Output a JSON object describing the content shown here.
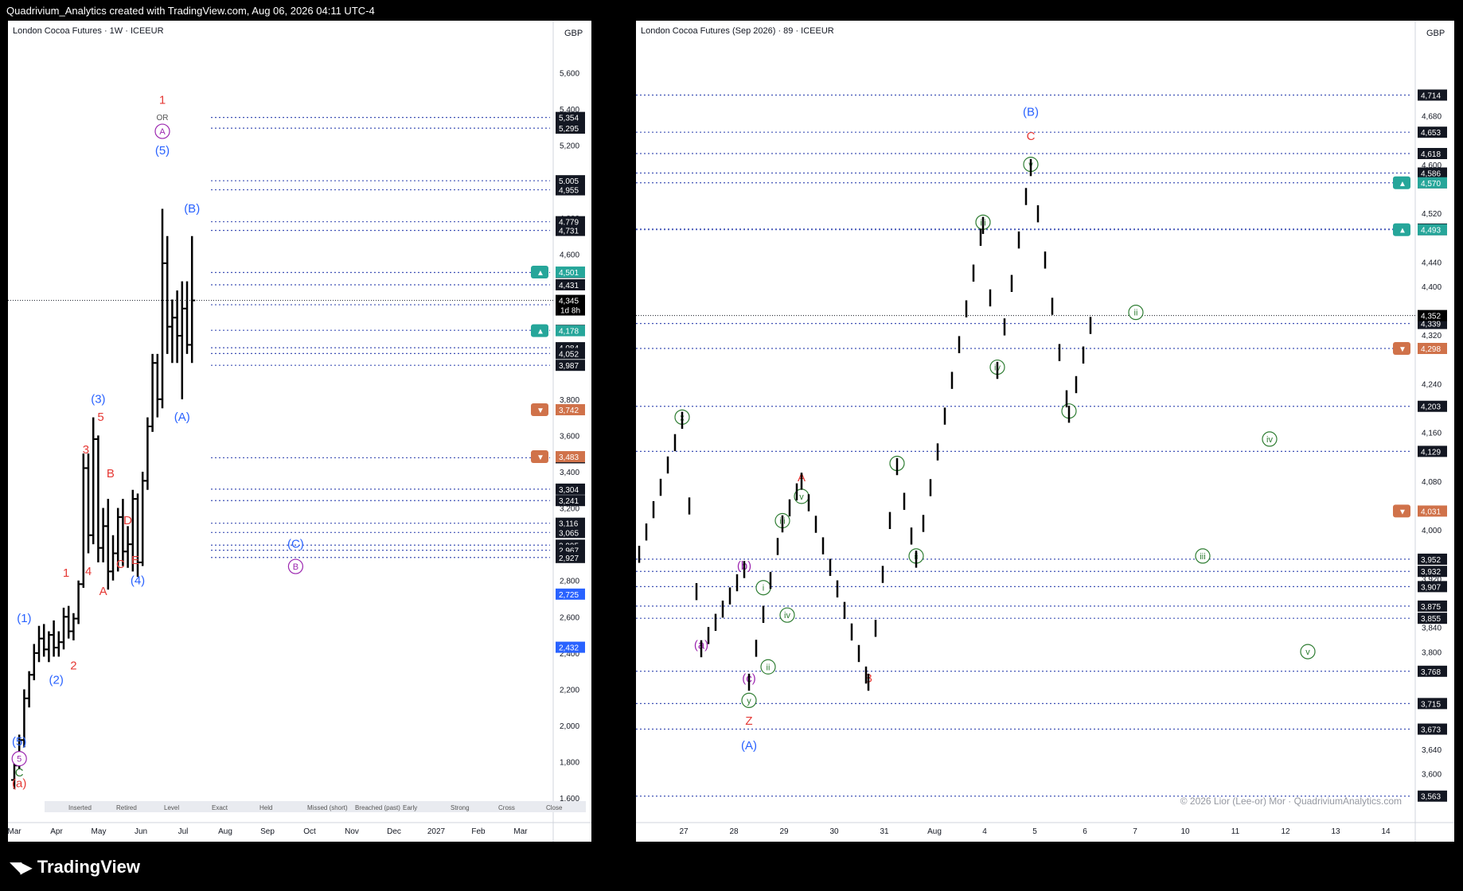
{
  "header": {
    "caption": "Quadrivium_Analytics created with TradingView.com, Aug 06, 2026 04:11 UTC-4"
  },
  "footer": {
    "brand": "TradingView",
    "logo_icon": "tradingview-logo-icon"
  },
  "colors": {
    "up_marker": "#26a69a",
    "down_marker": "#d0724a",
    "wave_blue": "#2962ff",
    "wave_red": "#e53935",
    "wave_green": "#2e7d32",
    "wave_purple": "#9c27b0",
    "last_price": "#000000"
  },
  "chart_data": [
    {
      "type": "bar",
      "title": "London Cocoa Futures · 1W · ICEEUR",
      "currency": "GBP",
      "ylim": [
        1500,
        5800
      ],
      "y_ticks": [
        "5,600",
        "5,400",
        "5,200",
        "4,800",
        "4,600",
        "3,800",
        "3,600",
        "3,400",
        "3,200",
        "2,800",
        "2,600",
        "2,400",
        "2,200",
        "2,000",
        "1,800",
        "1,600"
      ],
      "x_ticks": [
        "Mar",
        "Apr",
        "May",
        "Jun",
        "Jul",
        "Aug",
        "Sep",
        "Oct",
        "Nov",
        "Dec",
        "2027",
        "Feb",
        "Mar"
      ],
      "levels": [
        "5,354",
        "5,295",
        "5,005",
        "4,955",
        "4,779",
        "4,731",
        "4,499",
        "4,431",
        "4,321",
        "4,180",
        "4,084",
        "4,052",
        "3,987",
        "3,477",
        "3,304",
        "3,241",
        "3,116",
        "3,065",
        "2,995",
        "2,967",
        "2,927"
      ],
      "price_markers": [
        {
          "label": "4,501",
          "value": 4501,
          "kind": "up"
        },
        {
          "label": "4,178",
          "value": 4178,
          "kind": "up"
        },
        {
          "label": "3,742",
          "value": 3742,
          "kind": "down"
        },
        {
          "label": "3,483",
          "value": 3483,
          "kind": "down"
        },
        {
          "label": "2,725",
          "value": 2725,
          "kind": "blue"
        },
        {
          "label": "2,432",
          "value": 2432,
          "kind": "blue"
        }
      ],
      "last_price": {
        "value": "4,345",
        "sub": "1d 8h"
      },
      "wave_labels": [
        {
          "text": "1",
          "color": "red",
          "week": 30,
          "value": 5430
        },
        {
          "text": "OR",
          "color": "gray",
          "week": 30,
          "value": 5340
        },
        {
          "text": "A",
          "color": "purple",
          "week": 30,
          "value": 5260
        },
        {
          "text": "(5)",
          "color": "blue",
          "week": 30,
          "value": 5150
        },
        {
          "text": "(B)",
          "color": "blue",
          "week": 36,
          "value": 4830
        },
        {
          "text": "(A)",
          "color": "blue",
          "week": 34,
          "value": 3680
        },
        {
          "text": "(3)",
          "color": "blue",
          "week": 17,
          "value": 3780
        },
        {
          "text": "5",
          "color": "red",
          "week": 17.5,
          "value": 3680
        },
        {
          "text": "3",
          "color": "red",
          "week": 14.5,
          "value": 3500
        },
        {
          "text": "B",
          "color": "red",
          "week": 19.5,
          "value": 3370
        },
        {
          "text": "D",
          "color": "red",
          "week": 23,
          "value": 3110
        },
        {
          "text": "C",
          "color": "red",
          "week": 21.5,
          "value": 2870
        },
        {
          "text": "E",
          "color": "red",
          "week": 24.5,
          "value": 2890
        },
        {
          "text": "4",
          "color": "red",
          "week": 15,
          "value": 2830
        },
        {
          "text": "(4)",
          "color": "blue",
          "week": 25,
          "value": 2780
        },
        {
          "text": "A",
          "color": "red",
          "week": 18,
          "value": 2720
        },
        {
          "text": "1",
          "color": "red",
          "week": 10.5,
          "value": 2820
        },
        {
          "text": "2",
          "color": "red",
          "week": 12,
          "value": 2310
        },
        {
          "text": "(1)",
          "color": "blue",
          "week": 2,
          "value": 2570
        },
        {
          "text": "(2)",
          "color": "blue",
          "week": 8.5,
          "value": 2230
        },
        {
          "text": "(5)",
          "color": "blue",
          "week": 1,
          "value": 1890
        },
        {
          "text": "5",
          "color": "purple",
          "week": 1,
          "value": 1800
        },
        {
          "text": "C",
          "color": "green",
          "week": 1,
          "value": 1720
        },
        {
          "text": "(a)",
          "color": "red",
          "week": 1,
          "value": 1660
        },
        {
          "text": "(C)",
          "color": "blue",
          "week": 57,
          "value": 2980
        },
        {
          "text": "B",
          "color": "purple",
          "week": 57,
          "value": 2860
        }
      ],
      "legend": [
        "Inserted",
        "Retired",
        "Level",
        "Exact",
        "Held",
        "Missed (short)",
        "Breached (past)",
        "Early",
        "Strong",
        "Cross",
        "Close"
      ],
      "ohlc": [
        [
          1700,
          1800,
          1650,
          1780
        ],
        [
          1780,
          1950,
          1760,
          1920
        ],
        [
          1920,
          2200,
          1880,
          2150
        ],
        [
          2150,
          2300,
          2100,
          2280
        ],
        [
          2280,
          2450,
          2250,
          2400
        ],
        [
          2400,
          2550,
          2350,
          2480
        ],
        [
          2480,
          2560,
          2380,
          2420
        ],
        [
          2420,
          2520,
          2350,
          2500
        ],
        [
          2500,
          2580,
          2380,
          2430
        ],
        [
          2430,
          2520,
          2380,
          2460
        ],
        [
          2460,
          2650,
          2420,
          2600
        ],
        [
          2600,
          2660,
          2480,
          2520
        ],
        [
          2520,
          2620,
          2470,
          2590
        ],
        [
          2590,
          2800,
          2560,
          2780
        ],
        [
          2780,
          3500,
          2760,
          3420
        ],
        [
          3420,
          3500,
          2950,
          3050
        ],
        [
          3050,
          3700,
          3000,
          3580
        ],
        [
          3580,
          3600,
          2900,
          2980
        ],
        [
          2980,
          3200,
          2900,
          3100
        ],
        [
          3100,
          3250,
          2750,
          2850
        ],
        [
          2850,
          3050,
          2800,
          2950
        ],
        [
          2950,
          3200,
          2850,
          3150
        ],
        [
          3150,
          3250,
          2880,
          2960
        ],
        [
          2960,
          3100,
          2870,
          3000
        ],
        [
          3000,
          3300,
          2850,
          3250
        ],
        [
          3250,
          3280,
          2820,
          2900
        ],
        [
          2900,
          3400,
          2880,
          3350
        ],
        [
          3350,
          3700,
          3300,
          3650
        ],
        [
          3650,
          4050,
          3620,
          4000
        ],
        [
          4000,
          4050,
          3700,
          3800
        ],
        [
          3800,
          4850,
          3750,
          4550
        ],
        [
          4550,
          4700,
          4050,
          4200
        ],
        [
          4200,
          4350,
          4000,
          4250
        ],
        [
          4250,
          4400,
          4000,
          4150
        ],
        [
          4150,
          4450,
          3800,
          4300
        ],
        [
          4300,
          4450,
          4050,
          4100
        ],
        [
          4100,
          4700,
          4000,
          4345
        ]
      ]
    },
    {
      "type": "bar",
      "title": "London Cocoa Futures (Sep 2026) · 89 · ICEEUR",
      "currency": "GBP",
      "ylim": [
        3530,
        4810
      ],
      "y_ticks": [
        "4,680",
        "4,600",
        "4,520",
        "4,440",
        "4,400",
        "4,320",
        "4,240",
        "4,160",
        "4,080",
        "4,000",
        "3,920",
        "3,840",
        "3,800",
        "3,720",
        "3,640",
        "3,600"
      ],
      "x_ticks": [
        "27",
        "28",
        "29",
        "30",
        "31",
        "Aug",
        "4",
        "5",
        "6",
        "7",
        "10",
        "11",
        "12",
        "13",
        "14"
      ],
      "levels": [
        "4,714",
        "4,653",
        "4,618",
        "4,586",
        "4,570",
        "4,494",
        "4,493",
        "4,339",
        "4,298",
        "4,203",
        "4,129",
        "3,952",
        "3,932",
        "3,907",
        "3,875",
        "3,855",
        "3,768",
        "3,715",
        "3,673",
        "3,563"
      ],
      "price_markers": [
        {
          "label": "4,570",
          "value": 4570,
          "kind": "up"
        },
        {
          "label": "4,493",
          "value": 4493,
          "kind": "up"
        },
        {
          "label": "4,298",
          "value": 4298,
          "kind": "down"
        },
        {
          "label": "4,031",
          "value": 4031,
          "kind": "down"
        }
      ],
      "last_price": {
        "value": "4,352"
      },
      "wave_labels": [
        {
          "text": "(B)",
          "color": "blue",
          "bar": 82,
          "value": 4680
        },
        {
          "text": "C",
          "color": "red",
          "bar": 82,
          "value": 4640
        },
        {
          "text": "v",
          "color": "green-circle",
          "bar": 82,
          "value": 4595
        },
        {
          "text": "iii",
          "color": "green-circle",
          "bar": 72,
          "value": 4500
        },
        {
          "text": "ii",
          "color": "green-circle",
          "bar": 104,
          "value": 4352
        },
        {
          "text": "iv",
          "color": "green-circle",
          "bar": 75,
          "value": 4262
        },
        {
          "text": "i",
          "color": "green-circle",
          "bar": 90,
          "value": 4190
        },
        {
          "text": "iv",
          "color": "green-circle",
          "bar": 132,
          "value": 4144
        },
        {
          "text": "iii",
          "color": "green-circle",
          "bar": 118,
          "value": 3952
        },
        {
          "text": "v",
          "color": "green-circle",
          "bar": 140,
          "value": 3795
        },
        {
          "text": "x",
          "color": "green-circle",
          "bar": 9,
          "value": 4180
        },
        {
          "text": "i",
          "color": "green-circle",
          "bar": 54,
          "value": 4104
        },
        {
          "text": "ii",
          "color": "green-circle",
          "bar": 58,
          "value": 3952
        },
        {
          "text": "A",
          "color": "red",
          "bar": 34,
          "value": 4080
        },
        {
          "text": "v",
          "color": "green-circle",
          "bar": 34,
          "value": 4050
        },
        {
          "text": "iii",
          "color": "green-circle",
          "bar": 30,
          "value": 4010
        },
        {
          "text": "(b)",
          "color": "purple",
          "bar": 22,
          "value": 3935
        },
        {
          "text": "i",
          "color": "green-circle",
          "bar": 26,
          "value": 3900
        },
        {
          "text": "iv",
          "color": "green-circle",
          "bar": 31,
          "value": 3855
        },
        {
          "text": "(a)",
          "color": "purple",
          "bar": 13,
          "value": 3805
        },
        {
          "text": "ii",
          "color": "green-circle",
          "bar": 27,
          "value": 3770
        },
        {
          "text": "(c)",
          "color": "purple",
          "bar": 23,
          "value": 3750
        },
        {
          "text": "y",
          "color": "green-circle",
          "bar": 23,
          "value": 3715
        },
        {
          "text": "Z",
          "color": "red",
          "bar": 23,
          "value": 3680
        },
        {
          "text": "(A)",
          "color": "blue",
          "bar": 23,
          "value": 3640
        },
        {
          "text": "B",
          "color": "red",
          "bar": 48,
          "value": 3750
        }
      ],
      "copyright": "© 2026 Lior (Lee-or) Mor · QuadriviumAnalytics.com"
    }
  ]
}
